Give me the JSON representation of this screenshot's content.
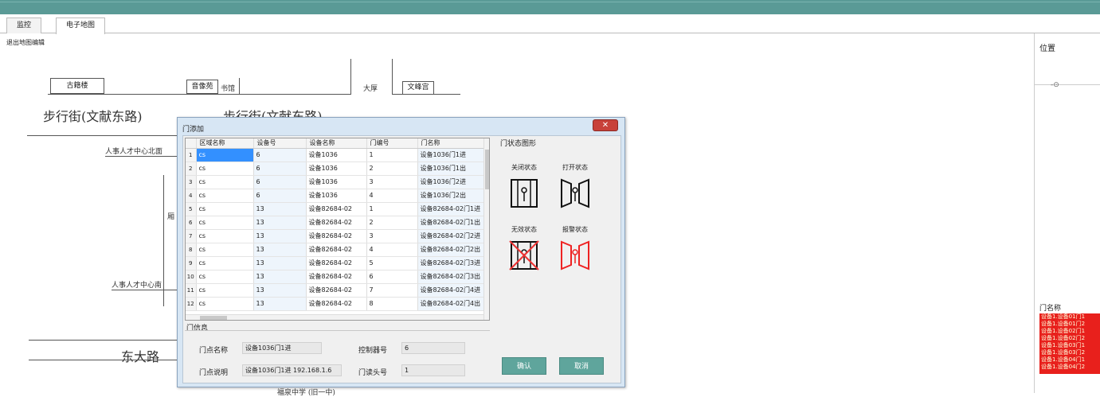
{
  "tabs": [
    "监控",
    "电子地图"
  ],
  "exit_link": "退出地图编辑",
  "map": {
    "buildings": [
      "古籍楼",
      "音像苑",
      "文峰宫"
    ],
    "labels": [
      "书馆",
      "大厚",
      "人事人才中心北面",
      "厢",
      "人事人才中心南",
      "福泉中学 (旧一中)"
    ],
    "streets": [
      "步行街(文献东路)",
      "步行街(文献东路)",
      "东大路"
    ]
  },
  "right_panel": {
    "title": "位置",
    "tree_node": "-⊙",
    "list_title": "门名称",
    "list_items": [
      "设备1.设备01门1",
      "设备1.设备01门2",
      "设备1.设备02门1",
      "设备1.设备02门2",
      "设备1.设备03门1",
      "设备1.设备03门2",
      "设备1.设备04门1",
      "设备1.设备04门2"
    ]
  },
  "dialog": {
    "title": "门添加",
    "close": "✕",
    "table": {
      "headers": [
        "区域名称",
        "设备号",
        "设备名称",
        "门编号",
        "门名称"
      ],
      "rows": [
        [
          "1",
          "cs",
          "6",
          "设备1036",
          "1",
          "设备1036门1进"
        ],
        [
          "2",
          "cs",
          "6",
          "设备1036",
          "2",
          "设备1036门1出"
        ],
        [
          "3",
          "cs",
          "6",
          "设备1036",
          "3",
          "设备1036门2进"
        ],
        [
          "4",
          "cs",
          "6",
          "设备1036",
          "4",
          "设备1036门2出"
        ],
        [
          "5",
          "cs",
          "13",
          "设备82684-02",
          "1",
          "设备82684-02门1进"
        ],
        [
          "6",
          "cs",
          "13",
          "设备82684-02",
          "2",
          "设备82684-02门1出"
        ],
        [
          "7",
          "cs",
          "13",
          "设备82684-02",
          "3",
          "设备82684-02门2进"
        ],
        [
          "8",
          "cs",
          "13",
          "设备82684-02",
          "4",
          "设备82684-02门2出"
        ],
        [
          "9",
          "cs",
          "13",
          "设备82684-02",
          "5",
          "设备82684-02门3进"
        ],
        [
          "10",
          "cs",
          "13",
          "设备82684-02",
          "6",
          "设备82684-02门3出"
        ],
        [
          "11",
          "cs",
          "13",
          "设备82684-02",
          "7",
          "设备82684-02门4进"
        ],
        [
          "12",
          "cs",
          "13",
          "设备82684-02",
          "8",
          "设备82684-02门4出"
        ]
      ]
    },
    "status_group": {
      "title": "门状态图形",
      "closed": "关闭状态",
      "open": "打开状态",
      "invalid": "无效状态",
      "alarm": "报警状态"
    },
    "info": {
      "title": "门信息",
      "door_name_label": "门点名称",
      "door_name_value": "设备1036门1进",
      "desc_label": "门点说明",
      "desc_value": "设备1036门1进  192.168.1.6",
      "ctrl_label": "控制器号",
      "ctrl_value": "6",
      "reader_label": "门读头号",
      "reader_value": "1"
    },
    "ok_button": "确认",
    "cancel_button": "取消"
  }
}
